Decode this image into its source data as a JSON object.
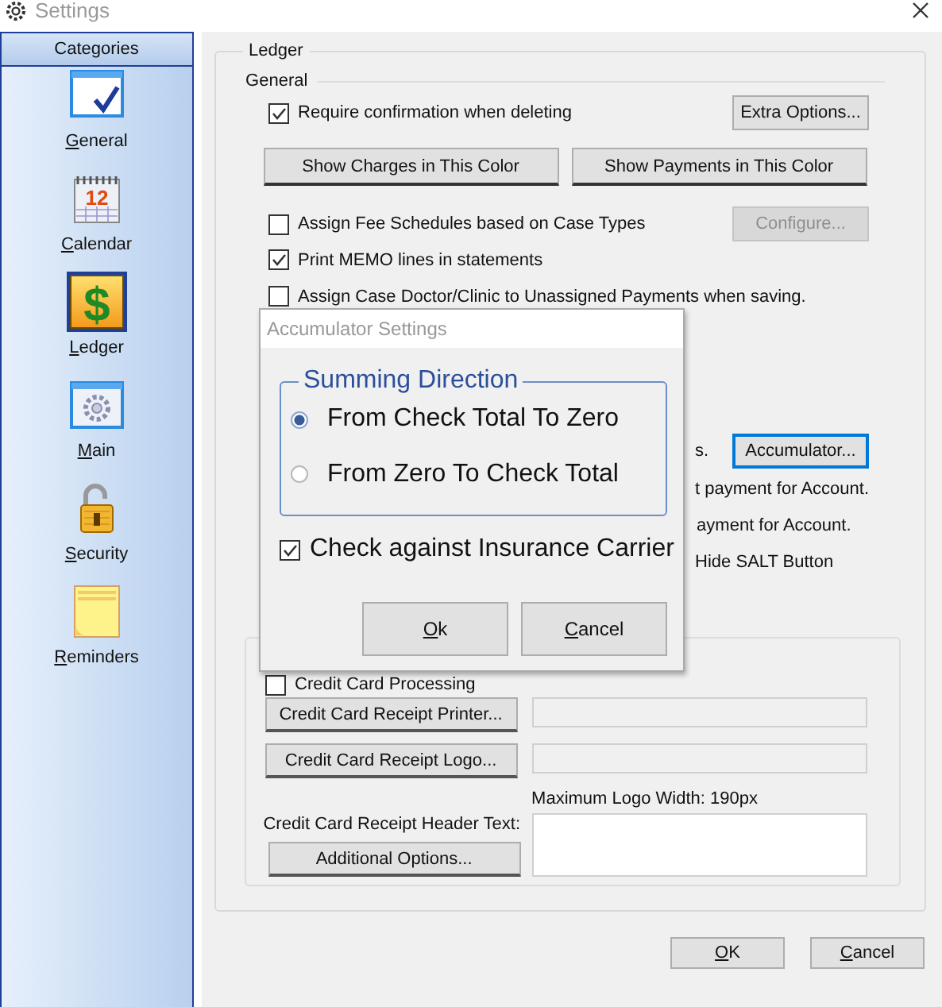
{
  "window": {
    "title": "Settings"
  },
  "sidebar": {
    "header": "Categories",
    "items": [
      {
        "label": "General",
        "selected": false
      },
      {
        "label": "Calendar",
        "glyph": "12",
        "selected": false
      },
      {
        "label": "Ledger",
        "glyph": "$",
        "selected": true
      },
      {
        "label": "Main",
        "selected": false
      },
      {
        "label": "Security",
        "selected": false
      },
      {
        "label": "Reminders",
        "selected": false
      }
    ]
  },
  "ledger": {
    "title": "Ledger",
    "general_title": "General",
    "options": [
      {
        "kind": "checkbox",
        "label": "Require confirmation when deleting",
        "checked": true,
        "button": {
          "label": "Extra Options...",
          "disabled": false
        }
      },
      {
        "kind": "buttons",
        "buttons": [
          "Show Charges in This Color",
          "Show Payments in This Color"
        ]
      },
      {
        "kind": "checkbox",
        "label": "Assign Fee Schedules based on Case Types",
        "checked": false,
        "button": {
          "label": "Configure...",
          "disabled": true
        }
      },
      {
        "kind": "checkbox",
        "label": "Print MEMO lines in statements",
        "checked": true
      },
      {
        "kind": "checkbox",
        "label": "Assign Case Doctor/Clinic to Unassigned Payments when saving.",
        "checked": false
      }
    ],
    "partial_rows": [
      {
        "text": "s.",
        "button": {
          "label": "Accumulator...",
          "focused": true
        }
      },
      {
        "text": "t payment for Account."
      },
      {
        "text": "ayment for Account."
      },
      {
        "text": "Hide SALT Button"
      }
    ],
    "credit_card": {
      "processing": {
        "label": "Credit Card Processing",
        "checked": false
      },
      "printer_button": "Credit Card Receipt Printer...",
      "logo_button": "Credit Card Receipt Logo...",
      "logo_note": "Maximum Logo Width: 190px",
      "header_label": "Credit Card Receipt Header Text:",
      "additional_button": "Additional Options..."
    }
  },
  "buttons": [
    "OK",
    "Cancel"
  ],
  "dialog": {
    "title": "Accumulator Settings",
    "group_title": "Summing Direction",
    "options": [
      {
        "label": "From Check Total To Zero",
        "selected": true
      },
      {
        "label": "From Zero To Check Total",
        "selected": false
      }
    ],
    "check": {
      "label": "Check against Insurance Carrier",
      "checked": true
    },
    "buttons": [
      "Ok",
      "Cancel"
    ]
  }
}
